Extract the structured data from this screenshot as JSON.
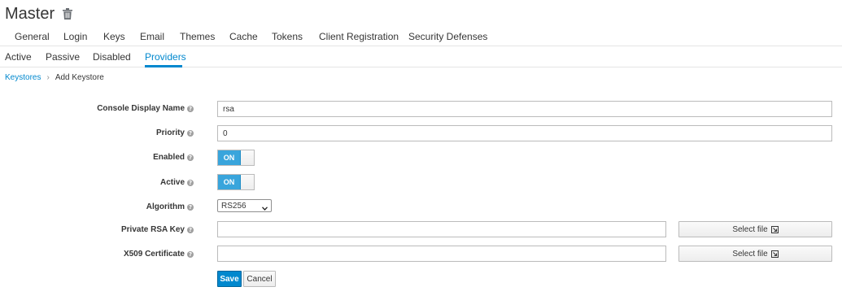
{
  "realm": {
    "title": "Master",
    "delete_icon": "trash-icon"
  },
  "main_tabs": [
    {
      "label": "General"
    },
    {
      "label": "Login"
    },
    {
      "label": "Keys"
    },
    {
      "label": "Email"
    },
    {
      "label": "Themes"
    },
    {
      "label": "Cache"
    },
    {
      "label": "Tokens"
    },
    {
      "label": "Client Registration"
    },
    {
      "label": "Security Defenses"
    }
  ],
  "sub_tabs": [
    {
      "label": "Active"
    },
    {
      "label": "Passive"
    },
    {
      "label": "Disabled"
    },
    {
      "label": "Providers",
      "active": true
    }
  ],
  "breadcrumb": {
    "parent": "Keystores",
    "separator": "›",
    "current": "Add Keystore"
  },
  "form": {
    "console_display_name": {
      "label": "Console Display Name",
      "value": "rsa"
    },
    "priority": {
      "label": "Priority",
      "value": "0"
    },
    "enabled": {
      "label": "Enabled",
      "state": "ON"
    },
    "active": {
      "label": "Active",
      "state": "ON"
    },
    "algorithm": {
      "label": "Algorithm",
      "selected": "RS256"
    },
    "private_rsa_key": {
      "label": "Private RSA Key",
      "value": "",
      "button": "Select file"
    },
    "x509_certificate": {
      "label": "X509 Certificate",
      "value": "",
      "button": "Select file"
    },
    "help_glyph": "?"
  },
  "actions": {
    "save": "Save",
    "cancel": "Cancel"
  },
  "colors": {
    "accent": "#0088ce",
    "toggle_on": "#39a5dc",
    "text": "#363636"
  }
}
